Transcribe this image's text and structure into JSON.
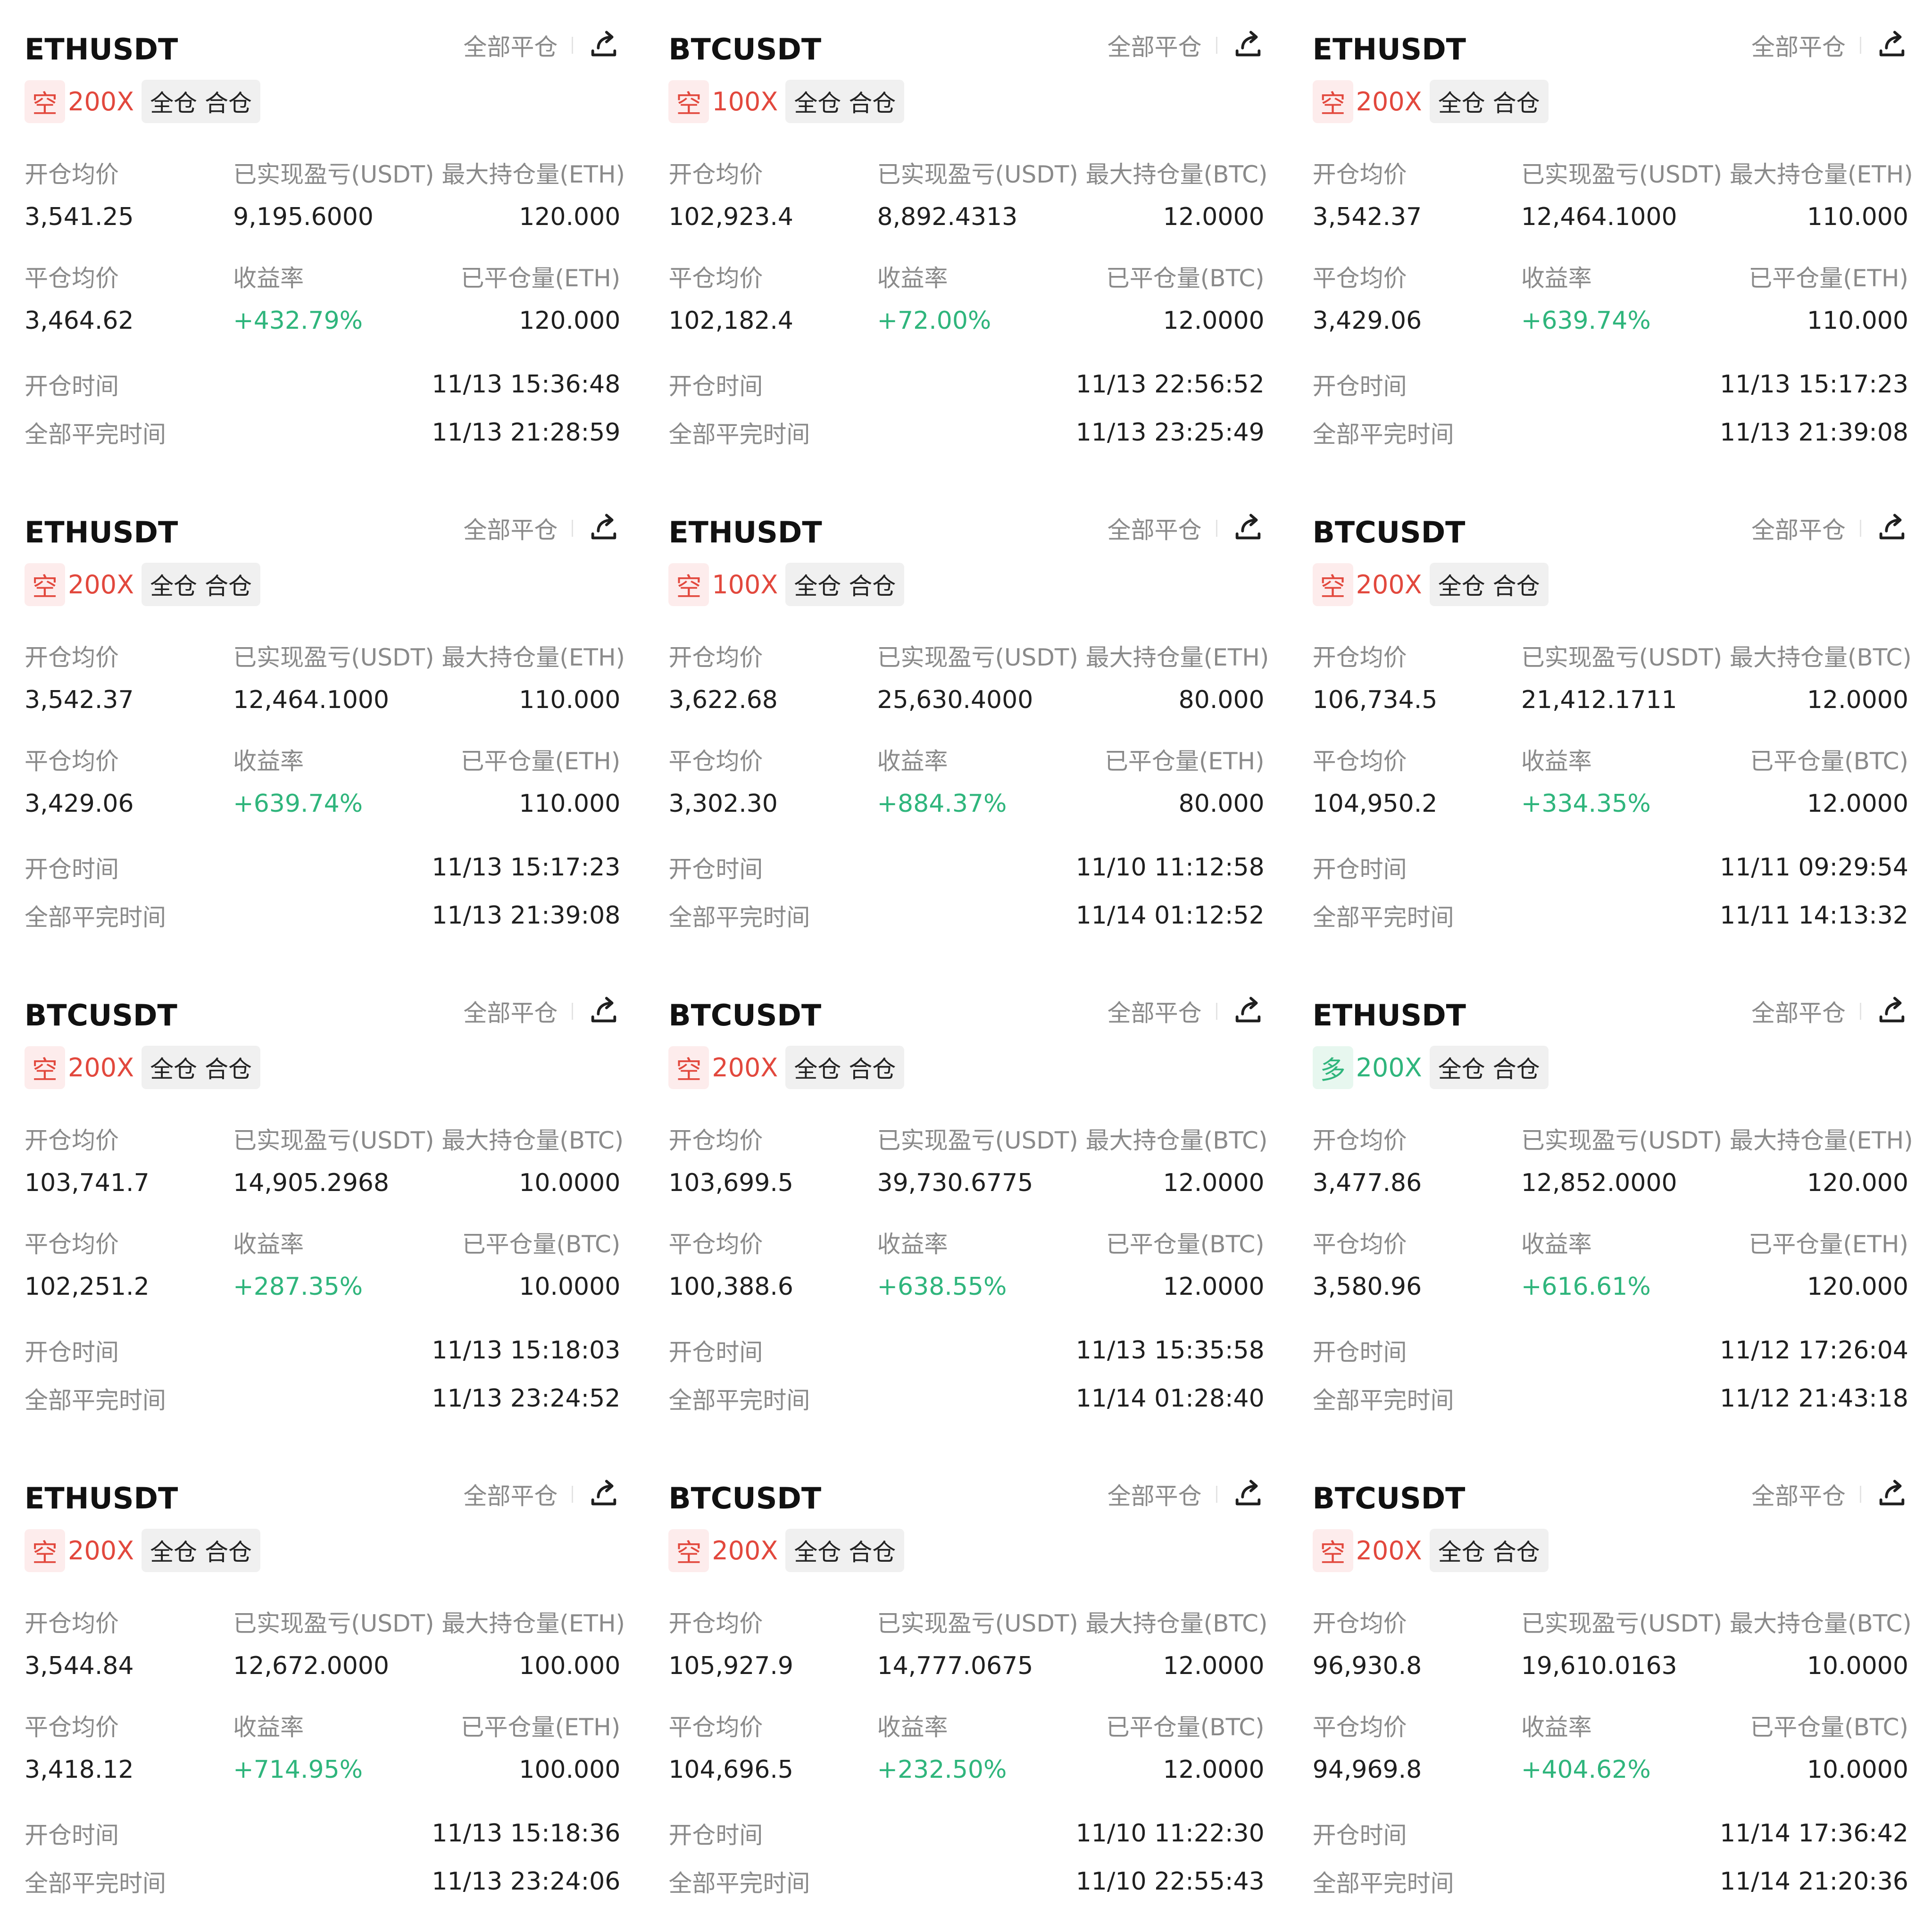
{
  "common": {
    "close_all_label": "全部平仓",
    "mode_label": "全仓 合仓",
    "open_avg_label": "开仓均价",
    "realized_pnl_label": "已实现盈亏(USDT)",
    "close_avg_label": "平仓均价",
    "roi_label": "收益率",
    "open_time_label": "开仓时间",
    "close_time_label": "全部平完时间"
  },
  "colors": {
    "short": "#e2483d",
    "long": "#2fb57c",
    "muted": "#8a8a8a"
  },
  "cards": [
    {
      "symbol": "ETHUSDT",
      "direction": "空",
      "leverage": "200X",
      "open_avg": "3,541.25",
      "realized_pnl": "9,195.6000",
      "max_pos_label": "最大持仓量(ETH)",
      "max_pos": "120.000",
      "close_avg": "3,464.62",
      "roi": "+432.79%",
      "closed_label": "已平仓量(ETH)",
      "closed": "120.000",
      "open_time": "11/13 15:36:48",
      "close_time": "11/13 21:28:59"
    },
    {
      "symbol": "BTCUSDT",
      "direction": "空",
      "leverage": "100X",
      "open_avg": "102,923.4",
      "realized_pnl": "8,892.4313",
      "max_pos_label": "最大持仓量(BTC)",
      "max_pos": "12.0000",
      "close_avg": "102,182.4",
      "roi": "+72.00%",
      "closed_label": "已平仓量(BTC)",
      "closed": "12.0000",
      "open_time": "11/13 22:56:52",
      "close_time": "11/13 23:25:49"
    },
    {
      "symbol": "ETHUSDT",
      "direction": "空",
      "leverage": "200X",
      "open_avg": "3,542.37",
      "realized_pnl": "12,464.1000",
      "max_pos_label": "最大持仓量(ETH)",
      "max_pos": "110.000",
      "close_avg": "3,429.06",
      "roi": "+639.74%",
      "closed_label": "已平仓量(ETH)",
      "closed": "110.000",
      "open_time": "11/13 15:17:23",
      "close_time": "11/13 21:39:08"
    },
    {
      "symbol": "ETHUSDT",
      "direction": "空",
      "leverage": "200X",
      "open_avg": "3,542.37",
      "realized_pnl": "12,464.1000",
      "max_pos_label": "最大持仓量(ETH)",
      "max_pos": "110.000",
      "close_avg": "3,429.06",
      "roi": "+639.74%",
      "closed_label": "已平仓量(ETH)",
      "closed": "110.000",
      "open_time": "11/13 15:17:23",
      "close_time": "11/13 21:39:08"
    },
    {
      "symbol": "ETHUSDT",
      "direction": "空",
      "leverage": "100X",
      "open_avg": "3,622.68",
      "realized_pnl": "25,630.4000",
      "max_pos_label": "最大持仓量(ETH)",
      "max_pos": "80.000",
      "close_avg": "3,302.30",
      "roi": "+884.37%",
      "closed_label": "已平仓量(ETH)",
      "closed": "80.000",
      "open_time": "11/10 11:12:58",
      "close_time": "11/14 01:12:52"
    },
    {
      "symbol": "BTCUSDT",
      "direction": "空",
      "leverage": "200X",
      "open_avg": "106,734.5",
      "realized_pnl": "21,412.1711",
      "max_pos_label": "最大持仓量(BTC)",
      "max_pos": "12.0000",
      "close_avg": "104,950.2",
      "roi": "+334.35%",
      "closed_label": "已平仓量(BTC)",
      "closed": "12.0000",
      "open_time": "11/11 09:29:54",
      "close_time": "11/11 14:13:32"
    },
    {
      "symbol": "BTCUSDT",
      "direction": "空",
      "leverage": "200X",
      "open_avg": "103,741.7",
      "realized_pnl": "14,905.2968",
      "max_pos_label": "最大持仓量(BTC)",
      "max_pos": "10.0000",
      "close_avg": "102,251.2",
      "roi": "+287.35%",
      "closed_label": "已平仓量(BTC)",
      "closed": "10.0000",
      "open_time": "11/13 15:18:03",
      "close_time": "11/13 23:24:52"
    },
    {
      "symbol": "BTCUSDT",
      "direction": "空",
      "leverage": "200X",
      "open_avg": "103,699.5",
      "realized_pnl": "39,730.6775",
      "max_pos_label": "最大持仓量(BTC)",
      "max_pos": "12.0000",
      "close_avg": "100,388.6",
      "roi": "+638.55%",
      "closed_label": "已平仓量(BTC)",
      "closed": "12.0000",
      "open_time": "11/13 15:35:58",
      "close_time": "11/14 01:28:40"
    },
    {
      "symbol": "ETHUSDT",
      "direction": "多",
      "leverage": "200X",
      "open_avg": "3,477.86",
      "realized_pnl": "12,852.0000",
      "max_pos_label": "最大持仓量(ETH)",
      "max_pos": "120.000",
      "close_avg": "3,580.96",
      "roi": "+616.61%",
      "closed_label": "已平仓量(ETH)",
      "closed": "120.000",
      "open_time": "11/12 17:26:04",
      "close_time": "11/12 21:43:18"
    },
    {
      "symbol": "ETHUSDT",
      "direction": "空",
      "leverage": "200X",
      "open_avg": "3,544.84",
      "realized_pnl": "12,672.0000",
      "max_pos_label": "最大持仓量(ETH)",
      "max_pos": "100.000",
      "close_avg": "3,418.12",
      "roi": "+714.95%",
      "closed_label": "已平仓量(ETH)",
      "closed": "100.000",
      "open_time": "11/13 15:18:36",
      "close_time": "11/13 23:24:06"
    },
    {
      "symbol": "BTCUSDT",
      "direction": "空",
      "leverage": "200X",
      "open_avg": "105,927.9",
      "realized_pnl": "14,777.0675",
      "max_pos_label": "最大持仓量(BTC)",
      "max_pos": "12.0000",
      "close_avg": "104,696.5",
      "roi": "+232.50%",
      "closed_label": "已平仓量(BTC)",
      "closed": "12.0000",
      "open_time": "11/10 11:22:30",
      "close_time": "11/10 22:55:43"
    },
    {
      "symbol": "BTCUSDT",
      "direction": "空",
      "leverage": "200X",
      "open_avg": "96,930.8",
      "realized_pnl": "19,610.0163",
      "max_pos_label": "最大持仓量(BTC)",
      "max_pos": "10.0000",
      "close_avg": "94,969.8",
      "roi": "+404.62%",
      "closed_label": "已平仓量(BTC)",
      "closed": "10.0000",
      "open_time": "11/14 17:36:42",
      "close_time": "11/14 21:20:36"
    }
  ]
}
